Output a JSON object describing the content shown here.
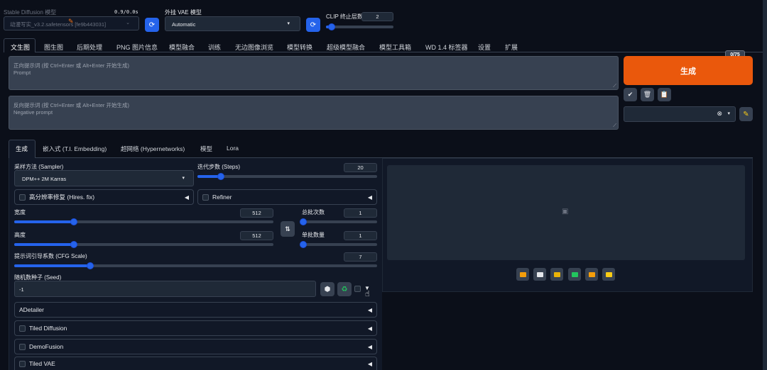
{
  "top": {
    "model_label": "Stable Diffusion 模型",
    "model_value": "动漫写实_v3.2.safetensors [fe9b443031]",
    "timing": "0.9/0.0s",
    "vae_label": "外挂 VAE 模型",
    "vae_value": "Automatic",
    "clip_label": "CLIP 终止层数",
    "clip_value": "2",
    "clip_fraction": 0.083
  },
  "tabs": [
    "文生图",
    "图生图",
    "后期处理",
    "PNG 图片信息",
    "模型融合",
    "训练",
    "无边图像浏览",
    "模型转换",
    "超级模型融合",
    "模型工具箱",
    "WD 1.4 标签器",
    "设置",
    "扩展"
  ],
  "prompt": {
    "pos_placeholder_1": "正向提示词 (按 Ctrl+Enter 或 Alt+Enter 开始生成)",
    "pos_placeholder_2": "Prompt",
    "neg_placeholder_1": "反向提示词 (按 Ctrl+Enter 或 Alt+Enter 开始生成)",
    "neg_placeholder_2": "Negative prompt",
    "token_count": "0/75"
  },
  "generate": {
    "label": "生成",
    "color": "#ea580c"
  },
  "subtabs": [
    "生成",
    "嵌入式 (T.I. Embedding)",
    "超网络 (Hypernetworks)",
    "模型",
    "Lora"
  ],
  "params": {
    "sampler_label": "采样方法 (Sampler)",
    "sampler_value": "DPM++ 2M Karras",
    "steps_label": "迭代步数 (Steps)",
    "steps_value": "20",
    "steps_fraction": 0.13,
    "hires_label": "高分辨率修复 (Hires. fix)",
    "refiner_label": "Refiner",
    "width_label": "宽度",
    "width_value": "512",
    "width_fraction": 0.23,
    "height_label": "高度",
    "height_value": "512",
    "height_fraction": 0.23,
    "batch_count_label": "总批次数",
    "batch_count_value": "1",
    "batch_count_fraction": 0.02,
    "batch_size_label": "单批数量",
    "batch_size_value": "1",
    "batch_size_fraction": 0.02,
    "cfg_label": "提示词引导系数 (CFG Scale)",
    "cfg_value": "7",
    "cfg_fraction": 0.21,
    "seed_label": "随机数种子 (Seed)",
    "seed_value": "-1"
  },
  "accordions": [
    {
      "label": "ADetailer",
      "checkbox": false
    },
    {
      "label": "Tiled Diffusion",
      "checkbox": true
    },
    {
      "label": "DemoFusion",
      "checkbox": true
    },
    {
      "label": "Tiled VAE",
      "checkbox": true
    }
  ],
  "output_tools": [
    {
      "name": "folder-icon",
      "color": "#f59e0b"
    },
    {
      "name": "save-icon",
      "color": "#e5e7eb"
    },
    {
      "name": "zip-icon",
      "color": "#eab308"
    },
    {
      "name": "send-to-img2img-icon",
      "color": "#22c55e"
    },
    {
      "name": "send-to-inpaint-icon",
      "color": "#f59e0b"
    },
    {
      "name": "send-to-extras-icon",
      "color": "#facc15"
    }
  ]
}
